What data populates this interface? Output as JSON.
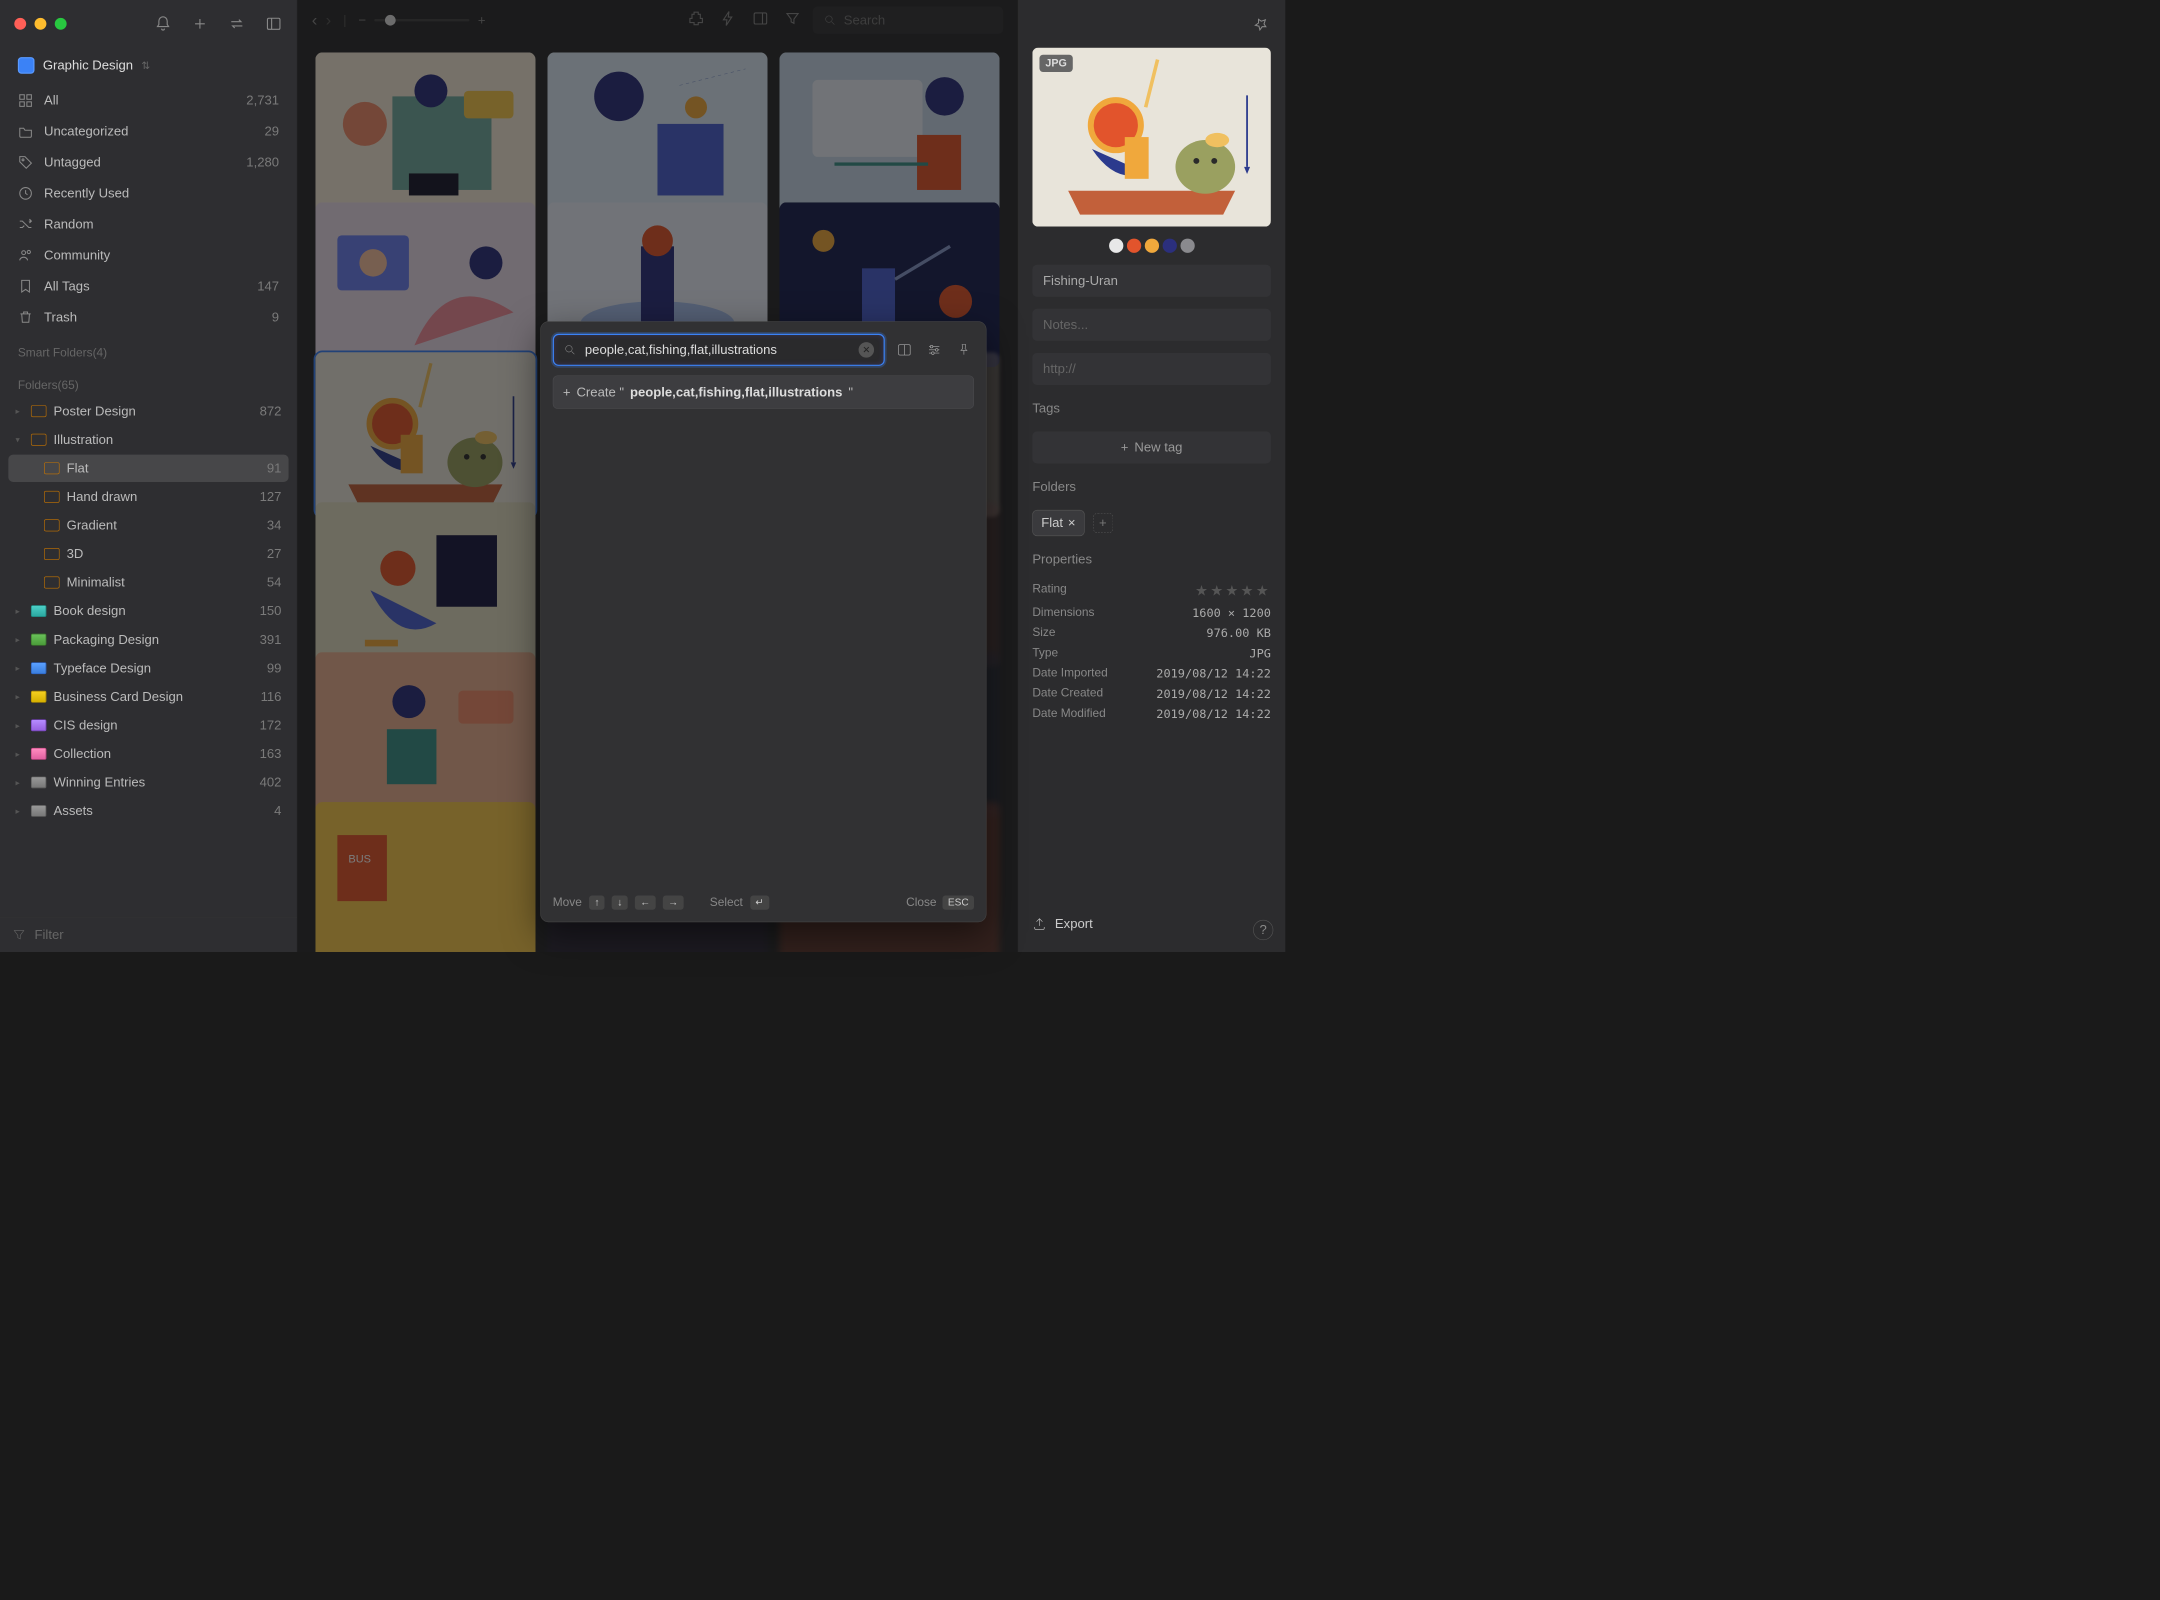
{
  "library": {
    "name": "Graphic Design"
  },
  "sidebar": {
    "items": [
      {
        "icon": "grid",
        "label": "All",
        "count": "2,731"
      },
      {
        "icon": "folder",
        "label": "Uncategorized",
        "count": "29"
      },
      {
        "icon": "tag",
        "label": "Untagged",
        "count": "1,280"
      },
      {
        "icon": "clock",
        "label": "Recently Used",
        "count": ""
      },
      {
        "icon": "shuffle",
        "label": "Random",
        "count": ""
      },
      {
        "icon": "people",
        "label": "Community",
        "count": ""
      },
      {
        "icon": "bookmark",
        "label": "All Tags",
        "count": "147"
      },
      {
        "icon": "trash",
        "label": "Trash",
        "count": "9"
      }
    ],
    "smart_label": "Smart Folders(4)",
    "folders_label": "Folders(65)",
    "folders": [
      {
        "color": "orange",
        "label": "Poster Design",
        "count": "872",
        "exp": false
      },
      {
        "color": "orange",
        "label": "Illustration",
        "count": "",
        "exp": true
      },
      {
        "color": "teal",
        "label": "Book design",
        "count": "150",
        "exp": false
      },
      {
        "color": "green",
        "label": "Packaging Design",
        "count": "391",
        "exp": false
      },
      {
        "color": "blue",
        "label": "Typeface Design",
        "count": "99",
        "exp": false
      },
      {
        "color": "yellow",
        "label": "Business Card Design",
        "count": "116",
        "exp": false
      },
      {
        "color": "purple",
        "label": "CIS design",
        "count": "172",
        "exp": false
      },
      {
        "color": "pink",
        "label": "Collection",
        "count": "163",
        "exp": false
      },
      {
        "color": "gray",
        "label": "Winning Entries",
        "count": "402",
        "exp": false
      },
      {
        "color": "gray",
        "label": "Assets",
        "count": "4",
        "exp": false
      }
    ],
    "subfolders": [
      {
        "label": "Flat",
        "count": "91",
        "selected": true
      },
      {
        "label": "Hand drawn",
        "count": "127"
      },
      {
        "label": "Gradient",
        "count": "34"
      },
      {
        "label": "3D",
        "count": "27"
      },
      {
        "label": "Minimalist",
        "count": "54"
      }
    ],
    "filter_placeholder": "Filter"
  },
  "toolbar": {
    "search_placeholder": "Search"
  },
  "popup": {
    "input_value": "people,cat,fishing,flat,illustrations",
    "create_prefix": "Create \"",
    "create_value": "people,cat,fishing,flat,illustrations",
    "create_suffix": "\"",
    "move_label": "Move",
    "select_label": "Select",
    "close_label": "Close",
    "esc_label": "ESC"
  },
  "inspector": {
    "badge": "JPG",
    "title": "Fishing-Uran",
    "notes_placeholder": "Notes...",
    "url_placeholder": "http://",
    "tags_label": "Tags",
    "new_tag": "New tag",
    "folders_label": "Folders",
    "folder_chip": "Flat",
    "props_label": "Properties",
    "swatches": [
      "#e8e8e8",
      "#e2542c",
      "#f0a83c",
      "#2b2f7d",
      "#8a8a8e"
    ],
    "props": [
      {
        "k": "Rating",
        "v": "★★★★★",
        "stars": true
      },
      {
        "k": "Dimensions",
        "v": "1600 × 1200"
      },
      {
        "k": "Size",
        "v": "976.00 KB"
      },
      {
        "k": "Type",
        "v": "JPG"
      },
      {
        "k": "Date Imported",
        "v": "2019/08/12 14:22"
      },
      {
        "k": "Date Created",
        "v": "2019/08/12 14:22"
      },
      {
        "k": "Date Modified",
        "v": "2019/08/12 14:22"
      }
    ],
    "export_label": "Export"
  }
}
